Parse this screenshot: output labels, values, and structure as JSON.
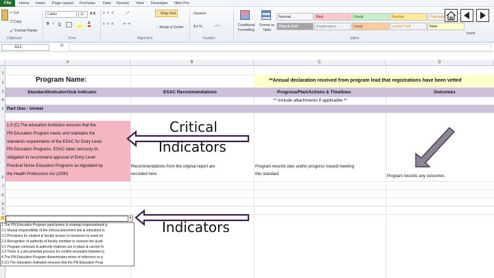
{
  "ribbon": {
    "tabs": [
      "File",
      "Home",
      "Insert",
      "Page Layout",
      "Formulas",
      "Data",
      "Review",
      "View",
      "Developer",
      "Nitro Pro"
    ],
    "clipboard": {
      "cut": "Cut",
      "copy": "Copy",
      "format_painter": "Format Painter",
      "group": "Clipboard"
    },
    "font": {
      "name": "Calibri",
      "size": "11",
      "group": "Font"
    },
    "alignment": {
      "wrap_text": "Wrap Text",
      "merge": "Merge & Center",
      "group": "Alignment"
    },
    "number": {
      "format": "General",
      "group": "Number"
    },
    "conditional_formatting": "Conditional Formatting",
    "format_as_table": "Format as Table",
    "styles": {
      "group": "Styles",
      "cells": [
        {
          "label": "Normal",
          "bg": "#ffffff",
          "fg": "#000000"
        },
        {
          "label": "Bad",
          "bg": "#ffc7ce",
          "fg": "#9c0006"
        },
        {
          "label": "Good",
          "bg": "#c6efce",
          "fg": "#006100"
        },
        {
          "label": "Neutral",
          "bg": "#ffeb9c",
          "fg": "#9c6500"
        },
        {
          "label": "Calculation",
          "bg": "#f2f2f2",
          "fg": "#fa7d00"
        },
        {
          "label": "Check Cell",
          "bg": "#a5a5a5",
          "fg": "#ffffff"
        },
        {
          "label": "Explanatory ...",
          "bg": "#ffffff",
          "fg": "#7f7f7f"
        },
        {
          "label": "Input",
          "bg": "#ffcc99",
          "fg": "#3f3f76"
        },
        {
          "label": "Linked Cell",
          "bg": "#ffffff",
          "fg": "#fa7d00"
        },
        {
          "label": "Note",
          "bg": "#ffffcc",
          "fg": "#000000"
        }
      ]
    },
    "insert": "Insert"
  },
  "formula_bar": {
    "cell_ref": "A12",
    "fx": "fx"
  },
  "grid": {
    "columns": [
      "A",
      "B",
      "C",
      "D"
    ],
    "rows": [
      "1",
      "2",
      "3",
      "4",
      "5",
      "6",
      "7",
      "8",
      "9",
      "0",
      "1",
      "2",
      "1",
      "2",
      "3",
      "4",
      "5",
      "6"
    ]
  },
  "sheet": {
    "program_name": "Program Name:",
    "annual_declaration": "**Annual declaration received from program lead that registrations have been vetted",
    "headers": {
      "a": "Standard/Indicator/Sub Indicator",
      "b": "ESAC Recommendations",
      "c": "Progress/Plan/Actions & Timelines",
      "d": "Outcomes"
    },
    "include_attachments": "** Include attachments if applicable **",
    "part_one": "Part One - Unmet",
    "standard_text": [
      "1.5 (C) The education institution ensures that the",
      "PN Education Program meets and maintains the",
      "standards requirements of the ESAC for Entry Level",
      "PN Education Programs. ESAC takes seriously its",
      "obligation to recommend approval of Entry Level",
      "Practical Nurse Education Programs as legislated by",
      "the Health Professions Act (2000)"
    ],
    "recommendation_text": [
      "Recommendations from the original report are",
      "recorded here"
    ],
    "progress_text": [
      "Program records plan and/or progress toward meeting",
      "this standard"
    ],
    "outcomes_text": "Program records any outcomes"
  },
  "dropdown": {
    "items": [
      "1 The PN Education Program participates in strategic/organizational p",
      "2.1 Mutual responsibility of the clinical placement site & education in",
      "2.2 Provisions for student & faculty access to resources to meet ed",
      "2.3 Recognition of authority of faculty member to oversee the acad",
      "3.1 Program contracts & authority matrices are in place & current fo",
      "3.2 There is a documented process for conflict resolution between p",
      "4 The PN Education Program disseminates terms of reference or p",
      "5 (C) The education institution ensures that the PN Education Prog"
    ]
  },
  "annotations": {
    "critical": [
      "Critical",
      "Indicators"
    ],
    "indicators": "Indicators"
  }
}
